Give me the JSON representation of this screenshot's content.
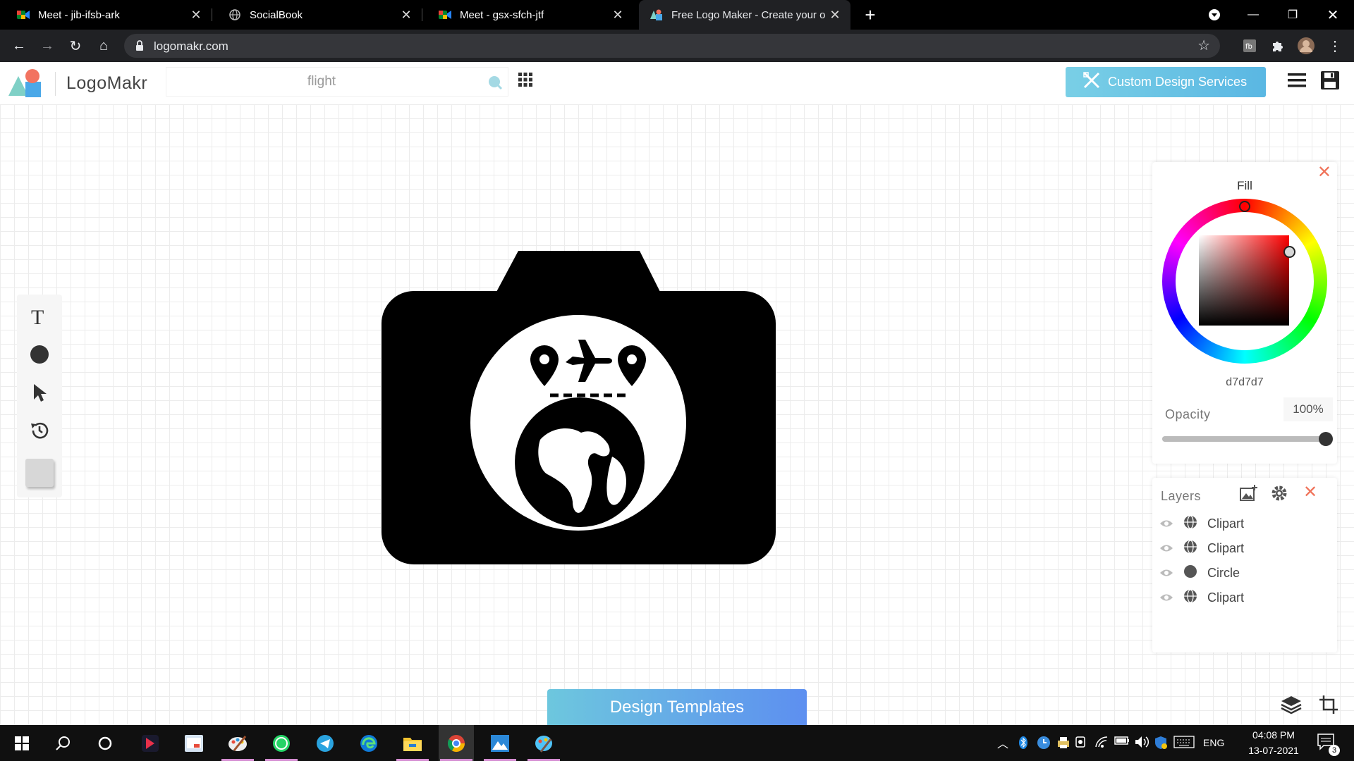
{
  "browser": {
    "tabs": [
      {
        "title": "Meet - jib-ifsb-ark",
        "icon": "google-meet-icon"
      },
      {
        "title": "SocialBook",
        "icon": "globe-icon"
      },
      {
        "title": "Meet - gsx-sfch-jtf",
        "icon": "google-meet-icon"
      },
      {
        "title": "Free Logo Maker - Create your o",
        "icon": "logomakr-icon",
        "active": true
      }
    ],
    "url": "logomakr.com"
  },
  "app": {
    "brand": "LogoMakr",
    "search_value": "flight",
    "custom_design_label": "Custom Design Services",
    "accent": "#5ab7e3"
  },
  "fill_panel": {
    "title": "Fill",
    "hex": "d7d7d7",
    "opacity_label": "Opacity",
    "opacity_value": "100%",
    "opacity_level": 1.0
  },
  "layers_panel": {
    "title": "Layers",
    "items": [
      {
        "label": "Clipart",
        "icon": "globe-icon"
      },
      {
        "label": "Clipart",
        "icon": "globe-icon"
      },
      {
        "label": "Circle",
        "icon": "circle-icon"
      },
      {
        "label": "Clipart",
        "icon": "globe-icon"
      }
    ]
  },
  "design_templates_label": "Design Templates",
  "taskbar": {
    "language": "ENG",
    "time": "04:08 PM",
    "date": "13-07-2021",
    "notifications": "3"
  }
}
